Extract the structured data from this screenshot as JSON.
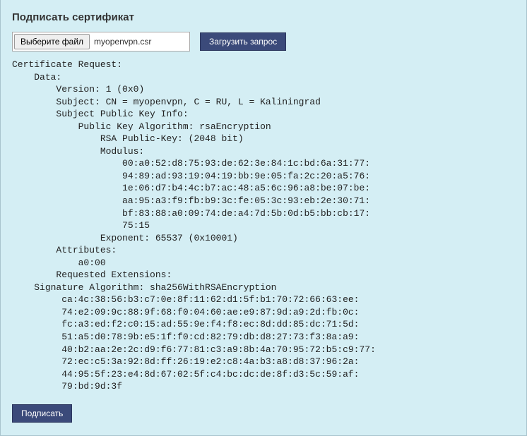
{
  "header": {
    "title": "Подписать сертификат"
  },
  "file": {
    "choose_label": "Выберите файл",
    "selected_name": "myopenvpn.csr"
  },
  "buttons": {
    "load_request": "Загрузить запрос",
    "sign": "Подписать"
  },
  "cert": {
    "line1": "Certificate Request:",
    "data_label": "Data:",
    "version": "Version: 1 (0x0)",
    "subject": "Subject: CN = myopenvpn, C = RU, L = Kaliningrad",
    "spki_label": "Subject Public Key Info:",
    "pka_label": "Public Key Algorithm: rsaEncryption",
    "rsa_key": "RSA Public-Key: (2048 bit)",
    "modulus_label": "Modulus:",
    "modulus": [
      "00:a0:52:d8:75:93:de:62:3e:84:1c:bd:6a:31:77:",
      "94:89:ad:93:19:04:19:bb:9e:05:fa:2c:20:a5:76:",
      "1e:06:d7:b4:4c:b7:ac:48:a5:6c:96:a8:be:07:be:",
      "aa:95:a3:f9:fb:b9:3c:fe:05:3c:93:eb:2e:30:71:",
      "bf:83:88:a0:09:74:de:a4:7d:5b:0d:b5:bb:cb:17:",
      "75:15"
    ],
    "exponent": "Exponent: 65537 (0x10001)",
    "attributes_label": "Attributes:",
    "attributes_value": "a0:00",
    "req_ext": "Requested Extensions:",
    "sig_alg": "Signature Algorithm: sha256WithRSAEncryption",
    "signature": [
      "ca:4c:38:56:b3:c7:0e:8f:11:62:d1:5f:b1:70:72:66:63:ee:",
      "74:e2:09:9c:88:9f:68:f0:04:60:ae:e9:87:9d:a9:2d:fb:0c:",
      "fc:a3:ed:f2:c0:15:ad:55:9e:f4:f8:ec:8d:dd:85:dc:71:5d:",
      "51:a5:d0:78:9b:e5:1f:f0:cd:82:79:db:d8:27:73:f3:8a:a9:",
      "40:b2:aa:2e:2c:d9:f6:77:81:c3:a9:8b:4a:70:95:72:b5:c9:77:",
      "72:ec:c5:3a:92:8d:ff:26:19:e2:c8:4a:b3:a8:d8:37:96:2a:",
      "44:95:5f:23:e4:8d:67:02:5f:c4:bc:dc:de:8f:d3:5c:59:af:",
      "79:bd:9d:3f"
    ]
  }
}
